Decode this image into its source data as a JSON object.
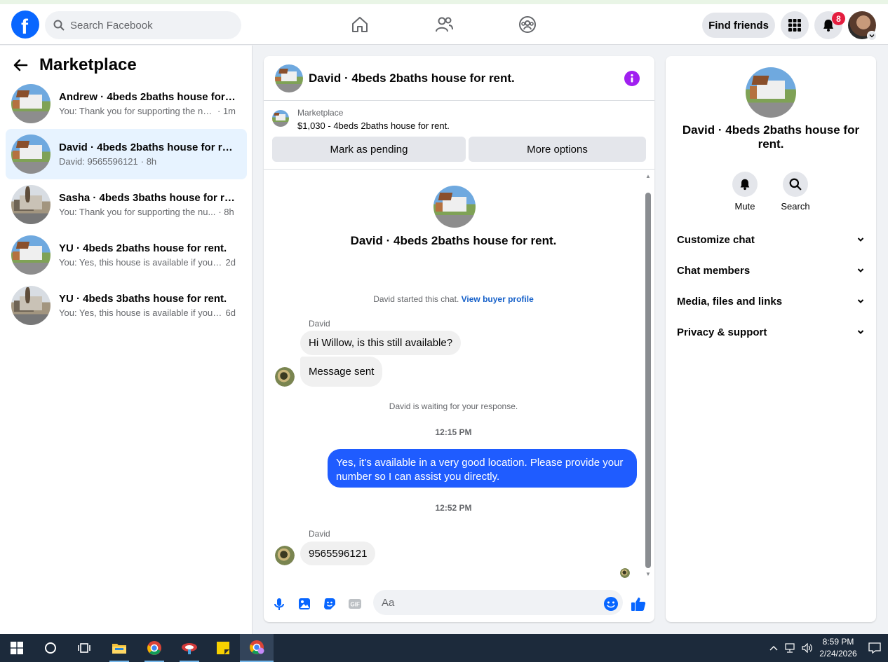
{
  "topbar": {
    "search_placeholder": "Search Facebook",
    "find_friends_label": "Find friends",
    "notification_count": "8"
  },
  "sidebar": {
    "title": "Marketplace",
    "conversations": [
      {
        "title": "Andrew · 4beds 2baths house for r...",
        "snippet": "You: Thank you for supporting the nu...",
        "time": "· 1m",
        "thumb": "house-a"
      },
      {
        "title": "David · 4beds 2baths house for rent.",
        "snippet": "David: 9565596121",
        "time": "· 8h",
        "thumb": "house-a"
      },
      {
        "title": "Sasha · 4beds 3baths house for rent.",
        "snippet": "You: Thank you for supporting the nu...",
        "time": "· 8h",
        "thumb": "house-b"
      },
      {
        "title": "YU · 4beds 2baths house for rent.",
        "snippet": "You: Yes, this house is available if you ...",
        "time": "2d",
        "thumb": "house-a"
      },
      {
        "title": "YU · 4beds 3baths house for rent.",
        "snippet": "You: Yes, this house is available if you ...",
        "time": "6d",
        "thumb": "house-b"
      }
    ]
  },
  "chat": {
    "header_title": "David · 4beds 2baths house for rent.",
    "listing_category": "Marketplace",
    "listing_price_title": "$1,030 - 4beds 2baths house for rent.",
    "mark_pending_label": "Mark as pending",
    "more_options_label": "More options",
    "hero_name": "David · 4beds 2baths house for rent.",
    "started_text": "David started this chat.",
    "view_profile_link": "View buyer profile",
    "sender_name": "David",
    "msg1": "Hi Willow, is this still available?",
    "msg2": "Message sent",
    "waiting_text": "David is waiting for your response.",
    "ts1": "12:15 PM",
    "outgoing_msg": "Yes, it’s available in a very good location. Please provide your number so I can assist you directly.",
    "ts2": "12:52 PM",
    "sender_name2": "David",
    "msg3": "9565596121",
    "composer_placeholder": "Aa"
  },
  "info_panel": {
    "name": "David · 4beds 2baths house for rent.",
    "mute_label": "Mute",
    "search_label": "Search",
    "sections": [
      "Customize chat",
      "Chat members",
      "Media, files and links",
      "Privacy & support"
    ]
  },
  "taskbar": {
    "time": "8:59 PM",
    "date": "2/24/2026"
  },
  "colors": {
    "brand_blue": "#0866ff",
    "outgoing_bubble": "#1f5cff",
    "info_purple": "#a020f0",
    "badge_red": "#e41e3f",
    "active_row": "#e7f3ff"
  },
  "icons": [
    "facebook-logo",
    "search-icon",
    "home-icon",
    "friends-icon",
    "groups-icon",
    "menu-grid-icon",
    "bell-icon",
    "back-arrow-icon",
    "info-icon",
    "mic-icon",
    "image-icon",
    "sticker-icon",
    "gif-icon",
    "emoji-icon",
    "like-icon",
    "chevron-down-icon",
    "windows-start-icon",
    "cortana-icon",
    "task-view-icon",
    "folder-icon",
    "chrome-icon",
    "notes-icon"
  ]
}
